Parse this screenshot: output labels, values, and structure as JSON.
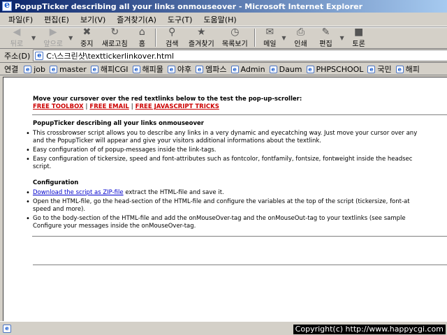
{
  "window": {
    "title": "PopupTicker describing all your links onmouseover - Microsoft Internet Explorer"
  },
  "menu": [
    "파일(F)",
    "편집(E)",
    "보기(V)",
    "즐겨찾기(A)",
    "도구(T)",
    "도움말(H)"
  ],
  "toolbar": {
    "back": "뒤로",
    "forward": "앞으로",
    "stop": "중지",
    "refresh": "새로고침",
    "home": "홈",
    "search": "검색",
    "favorites": "즐겨찾기",
    "history": "목록보기",
    "mail": "메일",
    "print": "인쇄",
    "edit": "편집",
    "discuss": "토론"
  },
  "address": {
    "label": "주소(D)",
    "value": "C:\\스크린샷\\texttickerlinkover.html"
  },
  "links_bar": {
    "label": "연결",
    "items": [
      "job",
      "master",
      "해피CGI",
      "해피몰",
      "야후",
      "엠파스",
      "Admin",
      "Daum",
      "PHPSCHOOL",
      "국민",
      "해피"
    ]
  },
  "content": {
    "intro": "Move your cursover over the red textlinks below to the test the pop-up-scroller:",
    "red_links": [
      "FREE TOOLBOX",
      "FREE EMAIL",
      "FREE JAVASCRIPT TRICKS"
    ],
    "red_sep": "|",
    "section1_title": "PopupTicker describing all your links onmouseover",
    "bullets1": [
      [
        "This crossbrowser script allows you to describe any links in a very dynamic and eyecatching way. Just move your cursor over any",
        "and the PopupTicker will appear and give your visitors additional informations about the textlink."
      ],
      [
        "Easy configuration of of popup-messages inside the link-tags."
      ],
      [
        "Easy configuration of tickersize, speed and font-attributes such as fontcolor, fontfamily, fontsize, fontweight inside the headsec",
        "script."
      ]
    ],
    "section2_title": "Configuration",
    "download_link": "Download the script as ZIP-file",
    "download_rest": " extract the HTML-file and save it.",
    "bullets2": [
      [
        "Open the HTML-file, go the head-section of the HTML-file and configure the variables at the top of the script (tickersize, font-at",
        "speed and more)."
      ],
      [
        "Go to the body-section of the HTML-file and add the onMouseOver-tag and the onMouseOut-tag to your textlinks (see sample",
        "Configure your messages inside the onMouseOver-tag."
      ]
    ]
  },
  "status": {
    "copyright": "Copyright(c) http://www.happycgi.com"
  }
}
